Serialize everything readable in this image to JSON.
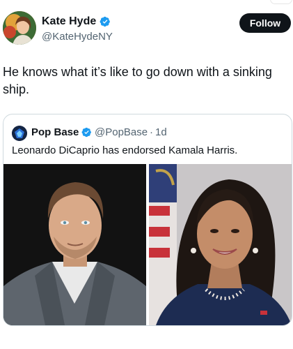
{
  "post": {
    "author": {
      "name": "Kate Hyde",
      "handle": "@KateHydeNY"
    },
    "follow_label": "Follow",
    "text": "He knows what it’s like to go down with a sinking ship."
  },
  "quote": {
    "author": {
      "name": "Pop Base",
      "handle": "@PopBase",
      "separator": "·",
      "time": "1d"
    },
    "text": "Leonardo DiCaprio has endorsed Kamala Harris.",
    "media": [
      "man-portrait-photo",
      "woman-portrait-photo"
    ]
  },
  "colors": {
    "verified": "#1d9bf0",
    "text": "#0f1419",
    "secondary": "#536471",
    "follow_bg": "#0f1419",
    "border": "#cfd9de"
  },
  "icons": [
    "verified-badge-icon"
  ]
}
